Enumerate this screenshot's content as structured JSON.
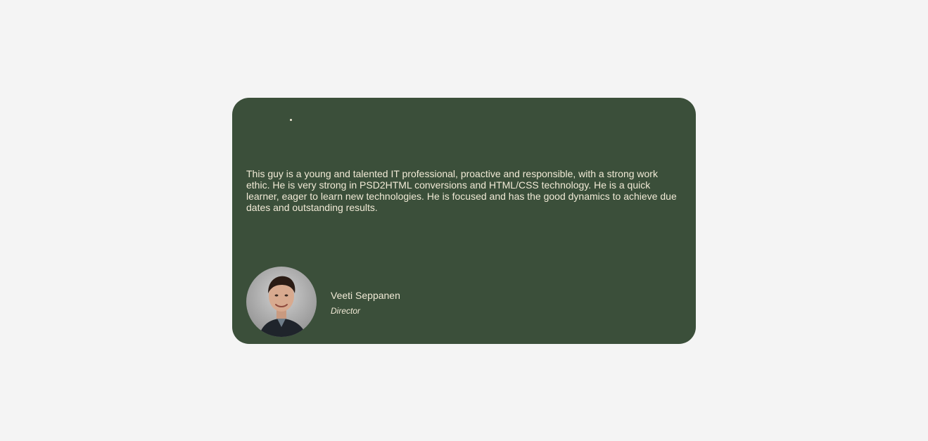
{
  "testimonial": {
    "text": "This guy is a young and talented IT professional, proactive and responsible, with a strong work ethic. He is very strong in PSD2HTML conversions and HTML/CSS technology. He is a quick learner, eager to learn new technologies. He is focused and has the good dynamics to achieve due dates and outstanding results.",
    "author_name": "Veeti Seppanen",
    "author_role": "Director",
    "avatar_icon": "person-portrait-photo",
    "quote_icon": "quote-mark-icon"
  },
  "colors": {
    "background": "#f4f4f4",
    "card": "#3b4f3a",
    "text": "#f1ead6"
  }
}
